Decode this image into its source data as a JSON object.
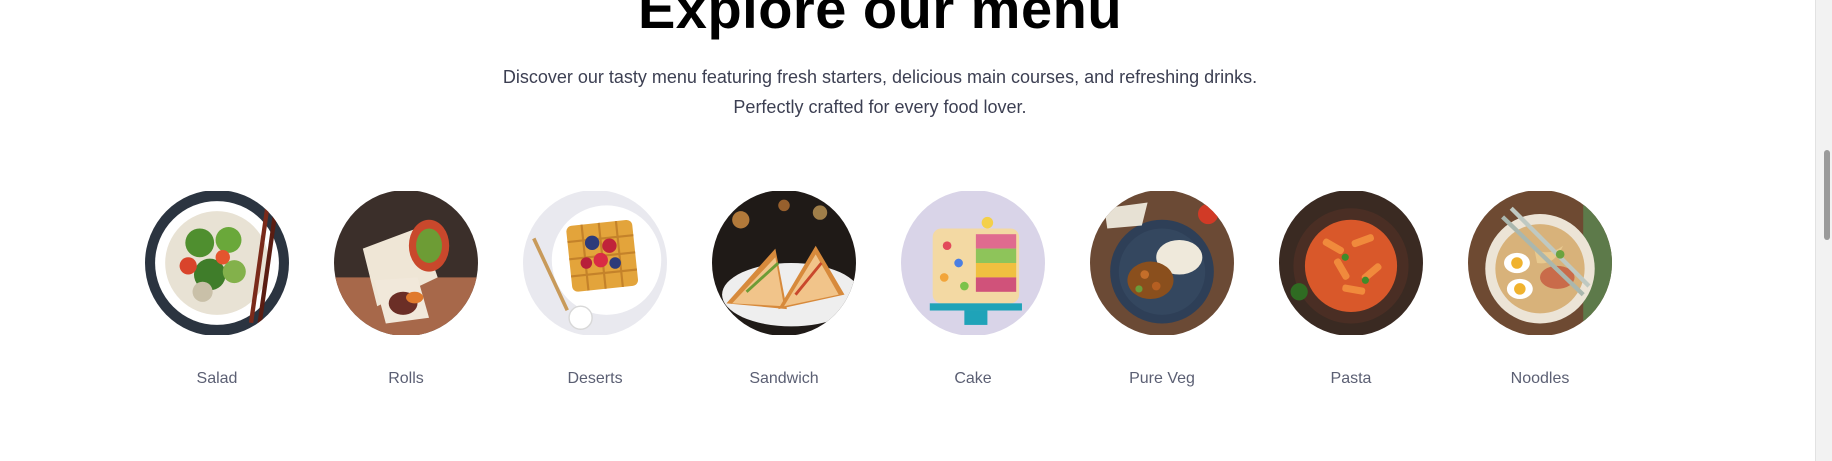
{
  "heading": "Explore our menu",
  "subtitle": {
    "line1": "Discover our tasty menu featuring fresh starters, delicious main courses, and refreshing drinks.",
    "line2": "Perfectly crafted for every food lover."
  },
  "menu": [
    {
      "label": "Salad",
      "icon": "salad-bowl-image"
    },
    {
      "label": "Rolls",
      "icon": "wrap-rolls-image"
    },
    {
      "label": "Deserts",
      "icon": "waffle-dessert-image"
    },
    {
      "label": "Sandwich",
      "icon": "sandwich-image"
    },
    {
      "label": "Cake",
      "icon": "cake-image"
    },
    {
      "label": "Pure Veg",
      "icon": "veg-curry-image"
    },
    {
      "label": "Pasta",
      "icon": "pasta-image"
    },
    {
      "label": "Noodles",
      "icon": "noodles-bowl-image"
    }
  ]
}
